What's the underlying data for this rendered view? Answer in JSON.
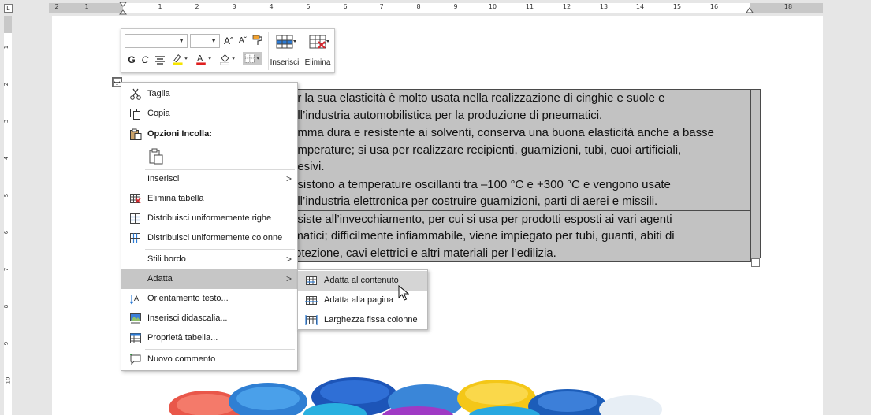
{
  "ruler": {
    "corner_glyph": "L",
    "h_numbers": [
      "2",
      "1",
      "1",
      "2",
      "3",
      "4",
      "5",
      "6",
      "7",
      "8",
      "9",
      "10",
      "11",
      "12",
      "13",
      "14",
      "15",
      "16",
      "18"
    ],
    "v_numbers": [
      "1",
      "2",
      "3",
      "4",
      "5",
      "6",
      "7",
      "8",
      "9",
      "10"
    ]
  },
  "mini_toolbar": {
    "font_value": "",
    "size_value": "",
    "grow_font": "Aˆ",
    "shrink_font": "Aˇ",
    "bold": "G",
    "italic": "C",
    "insert_label": "Inserisci",
    "delete_label": "Elimina"
  },
  "table": {
    "rows": [
      "er la sua elasticità è molto usata nella realizzazione di cinghie e suole e\nell’industria automobilistica per la produzione di pneumatici.",
      "omma dura e resistente ai solventi, conserva una buona elasticità anche a basse\nemperature; si usa per realizzare recipienti, guarnizioni, tubi, cuoi artificiali,\ndesivi.",
      "esistono a temperature oscillanti tra –100 °C e +300 °C e vengono usate\nell’industria elettronica per costruire guarnizioni, parti di aerei e missili.",
      "esiste all’invecchiamento, per cui si usa per prodotti esposti ai vari agenti\nimatici; difficilmente infiammabile, viene impiegato per tubi, guanti, abiti di\nrotezione, cavi elettrici e altri materiali per l’edilizia."
    ]
  },
  "context_menu": {
    "cut": "Taglia",
    "copy": "Copia",
    "paste_options": "Opzioni Incolla:",
    "insert": "Inserisci",
    "delete_table": "Elimina tabella",
    "distribute_rows": "Distribuisci uniformemente righe",
    "distribute_cols": "Distribuisci uniformemente colonne",
    "border_styles": "Stili bordo",
    "autofit": "Adatta",
    "text_direction": "Orientamento testo...",
    "insert_caption": "Inserisci didascalia...",
    "table_properties": "Proprietà tabella...",
    "new_comment": "Nuovo commento"
  },
  "submenu": {
    "fit_content": "Adatta al contenuto",
    "fit_window": "Adatta alla pagina",
    "fixed_width": "Larghezza fissa colonne"
  },
  "colors": {
    "highlight": "#c6c6c6",
    "table_bg": "#c2c2c2",
    "font_red": "#e02020",
    "highlight_yellow": "#f5e400"
  }
}
